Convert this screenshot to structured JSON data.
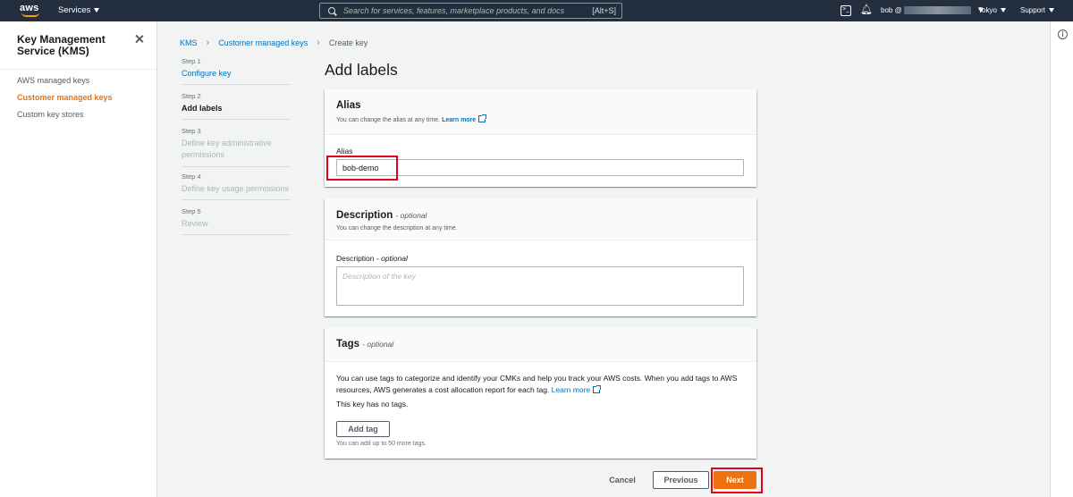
{
  "topnav": {
    "logo_text": "aws",
    "services_label": "Services",
    "search_placeholder": "Search for services, features, marketplace products, and docs",
    "search_shortcut": "[Alt+S]",
    "user_label": "bob @",
    "region_label": "Tokyo",
    "support_label": "Support",
    "colors": {
      "bg": "#232f3e",
      "accent": "#ff9900"
    }
  },
  "sidebar": {
    "title": "Key Management Service (KMS)",
    "items": [
      {
        "label": "AWS managed keys",
        "active": false
      },
      {
        "label": "Customer managed keys",
        "active": true
      },
      {
        "label": "Custom key stores",
        "active": false
      }
    ]
  },
  "breadcrumb": {
    "items": [
      "KMS",
      "Customer managed keys",
      "Create key"
    ]
  },
  "wizard": {
    "steps": [
      {
        "num": "Step 1",
        "label": "Configure key",
        "state": "link"
      },
      {
        "num": "Step 2",
        "label": "Add labels",
        "state": "current"
      },
      {
        "num": "Step 3",
        "label": "Define key administrative permissions",
        "state": "disabled"
      },
      {
        "num": "Step 4",
        "label": "Define key usage permissions",
        "state": "disabled"
      },
      {
        "num": "Step 5",
        "label": "Review",
        "state": "disabled"
      }
    ]
  },
  "page_title": "Add labels",
  "alias_panel": {
    "title": "Alias",
    "description": "You can change the alias at any time.",
    "learn_more": "Learn more",
    "field_label": "Alias",
    "field_value": "bob-demo"
  },
  "description_panel": {
    "title": "Description",
    "title_optional": "- optional",
    "description": "You can change the description at any time.",
    "field_label": "Description",
    "field_label_optional": "- optional",
    "placeholder": "Description of the key"
  },
  "tags_panel": {
    "title": "Tags",
    "title_optional": "- optional",
    "body_text": "You can use tags to categorize and identify your CMKs and help you track your AWS costs. When you add tags to AWS resources, AWS generates a cost allocation report for each tag.",
    "learn_more": "Learn more",
    "no_tags": "This key has no tags.",
    "add_tag_label": "Add tag",
    "limit_note": "You can add up to 50 more tags."
  },
  "footer": {
    "cancel_label": "Cancel",
    "previous_label": "Previous",
    "next_label": "Next",
    "colors": {
      "primary": "#ec7211",
      "highlight": "#e3001b"
    }
  }
}
